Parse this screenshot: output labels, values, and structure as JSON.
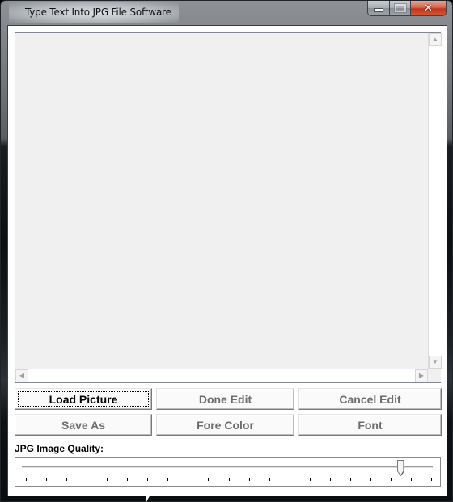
{
  "window": {
    "title": "Type Text Into JPG File Software",
    "caption_buttons": [
      {
        "name": "minimize",
        "icon": "minimize-icon"
      },
      {
        "name": "maximize",
        "icon": "maximize-icon",
        "enabled": false
      },
      {
        "name": "close",
        "icon": "close-icon",
        "glyph": "✕"
      }
    ]
  },
  "picture_area": {
    "scrollbars": {
      "vertical": {
        "up": "▲",
        "down": "▼"
      },
      "horizontal": {
        "left": "◀",
        "right": "▶"
      }
    }
  },
  "buttons": {
    "row1": [
      {
        "label": "Load Picture",
        "enabled": true,
        "focused": true
      },
      {
        "label": "Done Edit",
        "enabled": false
      },
      {
        "label": "Cancel Edit",
        "enabled": false
      }
    ],
    "row2": [
      {
        "label": "Save As",
        "enabled": false
      },
      {
        "label": "Fore Color",
        "enabled": false
      },
      {
        "label": "Font",
        "enabled": false
      }
    ]
  },
  "quality": {
    "label": "JPG Image Quality:",
    "tick_count": 21,
    "value_fraction": 0.925
  }
}
